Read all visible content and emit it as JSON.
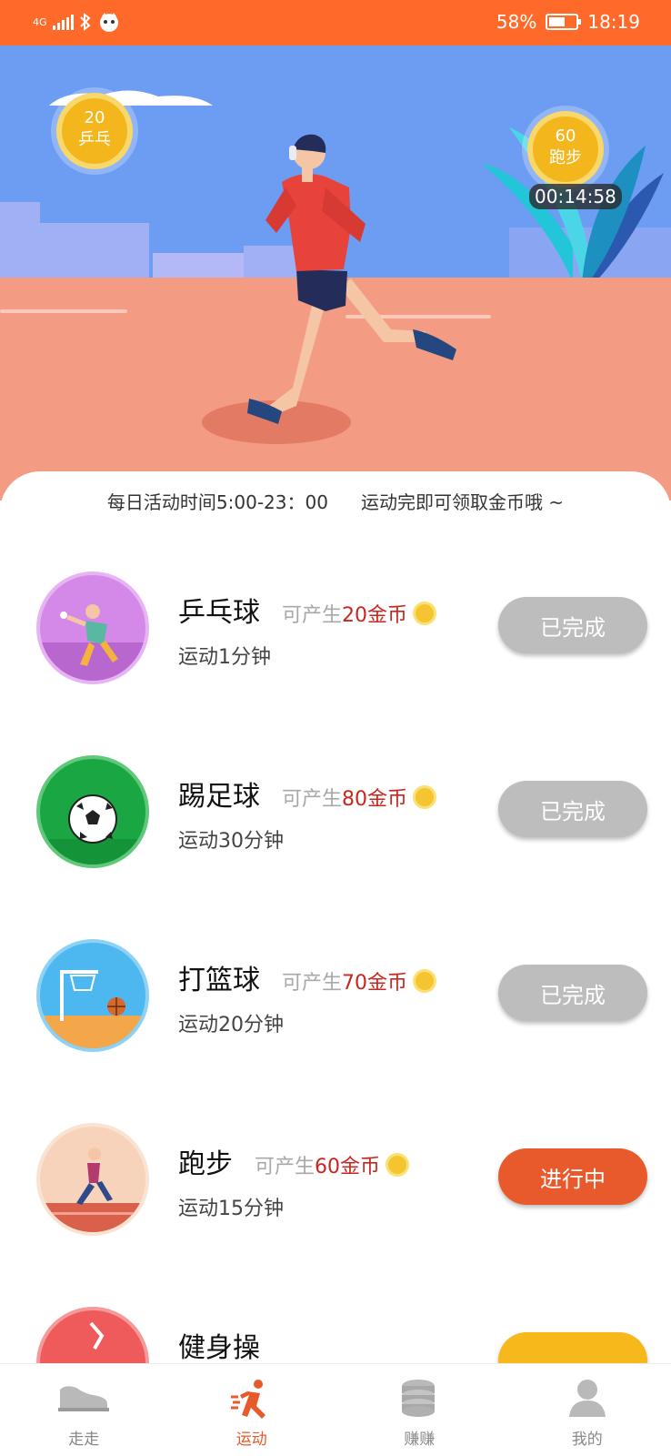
{
  "status_bar": {
    "network": "4G",
    "battery": "58%",
    "battery_level": 0.58,
    "time": "18:19"
  },
  "hero": {
    "left_badge": {
      "amount": "20",
      "name": "乒乓"
    },
    "right_badge": {
      "amount": "60",
      "name": "跑步"
    },
    "timer": "00:14:58"
  },
  "notice": {
    "hours": "每日活动时间5:00-23：00",
    "tip": "运动完即可领取金币哦 ~"
  },
  "activities": [
    {
      "title": "乒乓球",
      "reward_prefix": "可产生",
      "reward_amount": "20金币",
      "duration": "运动1分钟",
      "button": "已完成",
      "state": "done"
    },
    {
      "title": "踢足球",
      "reward_prefix": "可产生",
      "reward_amount": "80金币",
      "duration": "运动30分钟",
      "button": "已完成",
      "state": "done"
    },
    {
      "title": "打篮球",
      "reward_prefix": "可产生",
      "reward_amount": "70金币",
      "duration": "运动20分钟",
      "button": "已完成",
      "state": "done"
    },
    {
      "title": "跑步",
      "reward_prefix": "可产生",
      "reward_amount": "60金币",
      "duration": "运动15分钟",
      "button": "进行中",
      "state": "in-progress"
    },
    {
      "title": "健身操"
    }
  ],
  "nav": {
    "items": [
      {
        "label": "走走",
        "icon": "shoe-icon"
      },
      {
        "label": "运动",
        "icon": "runner-icon",
        "active": true
      },
      {
        "label": "赚赚",
        "icon": "coins-stack-icon"
      },
      {
        "label": "我的",
        "icon": "user-icon"
      }
    ]
  },
  "colors": {
    "accent": "#e8592c",
    "status_bar": "#ff6a2b",
    "reward": "#c8261e",
    "done_button": "#bdbdbd"
  }
}
